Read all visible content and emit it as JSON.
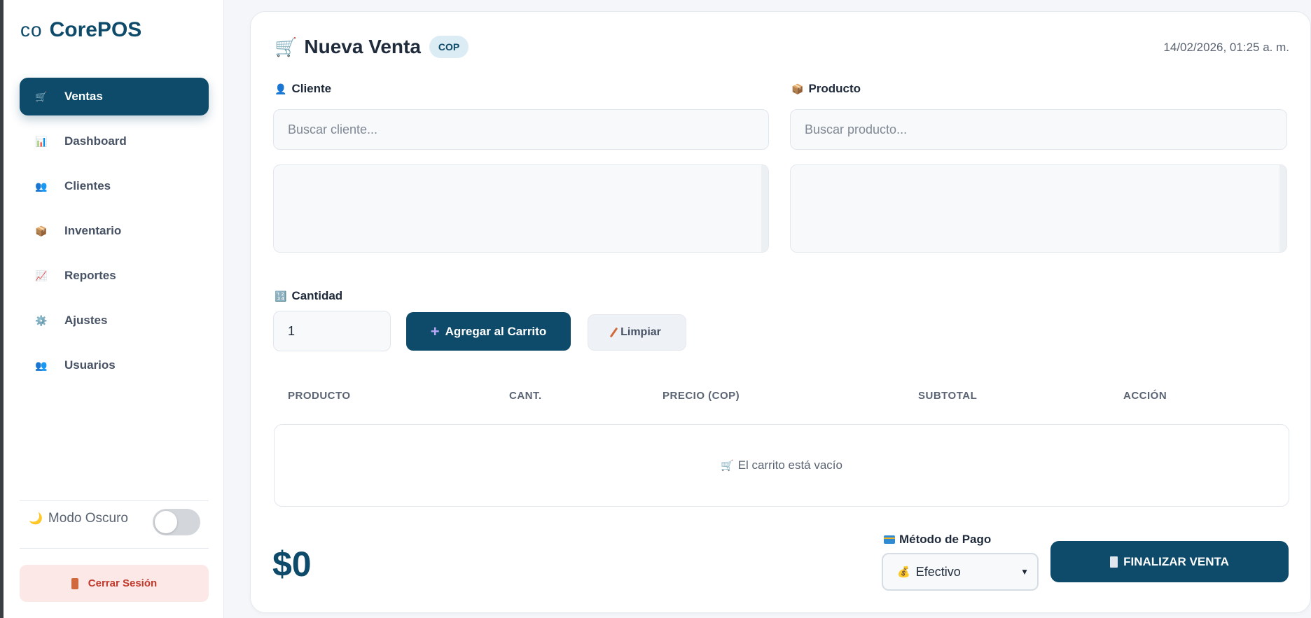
{
  "brand": {
    "mark": "co",
    "name": "CorePOS"
  },
  "sidebar": {
    "items": [
      {
        "label": "Ventas",
        "icon": "🛒",
        "active": true
      },
      {
        "label": "Dashboard",
        "icon": "📊"
      },
      {
        "label": "Clientes",
        "icon": "👥"
      },
      {
        "label": "Inventario",
        "icon": "📦"
      },
      {
        "label": "Reportes",
        "icon": "📈"
      },
      {
        "label": "Ajustes",
        "icon": "⚙️"
      },
      {
        "label": "Usuarios",
        "icon": "👥"
      }
    ],
    "dark_mode_label": "Modo Oscuro",
    "dark_mode_icon": "🌙",
    "dark_mode_on": false,
    "logout_label": "Cerrar Sesión"
  },
  "header": {
    "icon": "🛒",
    "title": "Nueva Venta",
    "currency": "COP",
    "datetime": "14/02/2026, 01:25 a. m."
  },
  "client": {
    "icon": "👤",
    "label": "Cliente",
    "placeholder": "Buscar cliente..."
  },
  "product": {
    "icon": "📦",
    "label": "Producto",
    "placeholder": "Buscar producto..."
  },
  "quantity": {
    "icon": "🔢",
    "label": "Cantidad",
    "value": "1"
  },
  "buttons": {
    "add_icon": "+",
    "add_to_cart": "Agregar al Carrito",
    "clear": "Limpiar",
    "finalize": "FINALIZAR VENTA"
  },
  "table": {
    "columns": [
      "PRODUCTO",
      "CANT.",
      "PRECIO (COP)",
      "SUBTOTAL",
      "ACCIÓN"
    ],
    "empty_icon": "🛒",
    "empty_message": "El carrito está vacío"
  },
  "total": "$0",
  "payment": {
    "icon": "💳",
    "label": "Método de Pago",
    "selected_icon": "💰",
    "selected": "Efectivo"
  },
  "colors": {
    "primary": "#0e4a6a",
    "logout_bg": "#fde8e8",
    "logout_text": "#c0392b"
  }
}
